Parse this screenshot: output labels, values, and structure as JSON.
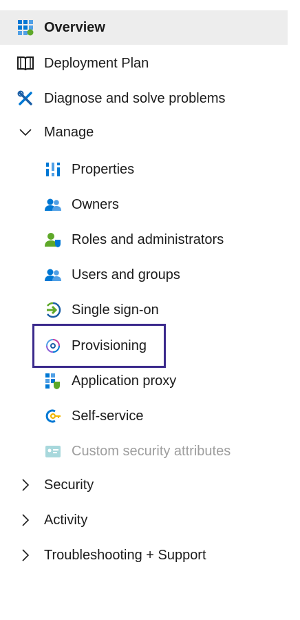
{
  "nav": {
    "overview": "Overview",
    "deployment_plan": "Deployment Plan",
    "diagnose": "Diagnose and solve problems",
    "manage": "Manage",
    "manage_items": {
      "properties": "Properties",
      "owners": "Owners",
      "roles": "Roles and administrators",
      "users_groups": "Users and groups",
      "sso": "Single sign-on",
      "provisioning": "Provisioning",
      "app_proxy": "Application proxy",
      "self_service": "Self-service",
      "custom_security": "Custom security attributes"
    },
    "security": "Security",
    "activity": "Activity",
    "troubleshooting": "Troubleshooting + Support"
  },
  "icons": {
    "overview": "grid-icon",
    "deployment_plan": "book-icon",
    "diagnose": "wrench-screwdriver-icon",
    "properties": "bars-icon",
    "owners": "people-icon",
    "roles": "user-shield-icon",
    "users_groups": "people-icon",
    "sso": "sign-in-arrow-icon",
    "provisioning": "provisioning-icon",
    "app_proxy": "app-grid-icon",
    "self_service": "key-icon",
    "custom_security": "id-card-icon"
  },
  "colors": {
    "accent_blue": "#0078d4",
    "selected_bg": "#ededed",
    "focus_border": "#3b2a8c",
    "disabled_text": "#9e9e9e"
  }
}
